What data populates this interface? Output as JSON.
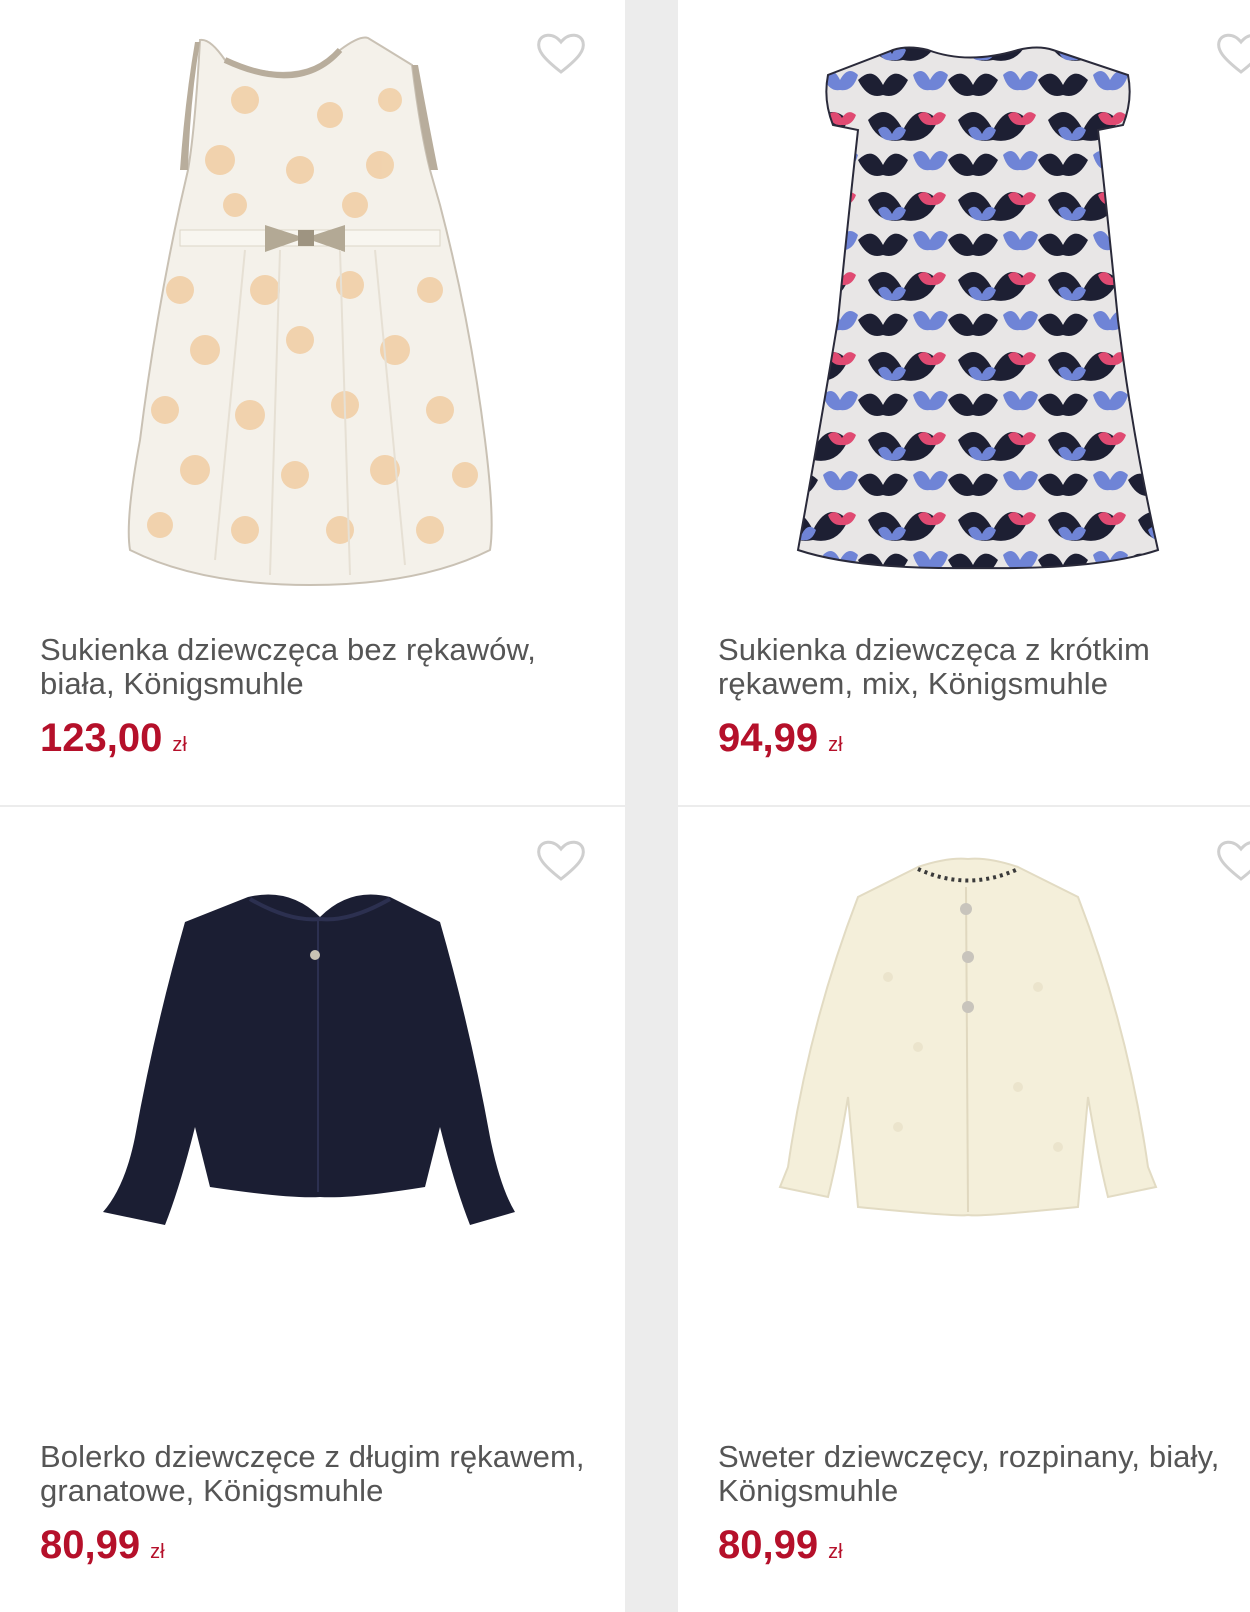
{
  "products": [
    {
      "title": "Sukienka dziewczęca bez rękawów, biała, Königsmuhle",
      "price": "123,00",
      "currency": "zł",
      "favorite_icon": "heart-outline-icon",
      "image": "sleeveless-white-dress"
    },
    {
      "title": "Sukienka dziewczęca z krótkim rękawem, mix, Königsmuhle",
      "price": "94,99",
      "currency": "zł",
      "favorite_icon": "heart-outline-icon",
      "image": "butterfly-print-dress"
    },
    {
      "title": "Bolerko dziewczęce z długim rękawem, granatowe, Königsmuhle",
      "price": "80,99",
      "currency": "zł",
      "favorite_icon": "heart-outline-icon",
      "image": "navy-bolero"
    },
    {
      "title": "Sweter dziewczęcy, rozpinany, biały, Königsmuhle",
      "price": "80,99",
      "currency": "zł",
      "favorite_icon": "heart-outline-icon",
      "image": "white-cardigan"
    }
  ],
  "colors": {
    "price": "#b5102a",
    "title": "#555555",
    "background": "#ececec",
    "card": "#ffffff"
  }
}
